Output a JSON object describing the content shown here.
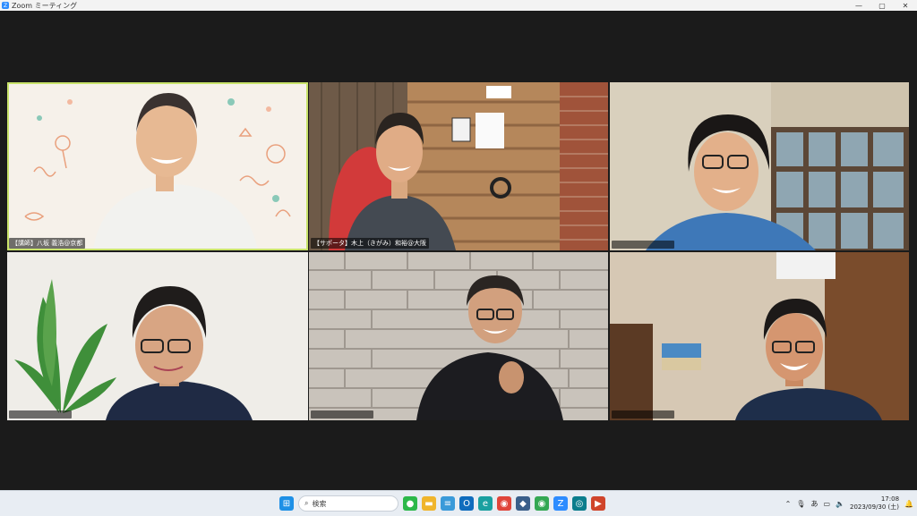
{
  "window": {
    "title": "Zoom ミーティング",
    "icon": "zoom-icon",
    "controls": [
      "minimize",
      "maximize",
      "close"
    ]
  },
  "participants": [
    {
      "id": "p1",
      "label": "【講師】八坂 義浩@京都",
      "active": true
    },
    {
      "id": "p2",
      "label": "【サポータ】木上（きがみ）和裕@大阪",
      "active": false
    },
    {
      "id": "p3",
      "label": "",
      "active": false
    },
    {
      "id": "p4",
      "label": "",
      "active": false
    },
    {
      "id": "p5",
      "label": "",
      "active": false
    },
    {
      "id": "p6",
      "label": "",
      "active": false
    }
  ],
  "taskbar": {
    "search_label": "検索",
    "time": "17:08",
    "date": "2023/09/30 (土)",
    "ime": "あ"
  },
  "colors": {
    "active_border": "#c9e36a",
    "stage_bg": "#1b1b1b"
  }
}
